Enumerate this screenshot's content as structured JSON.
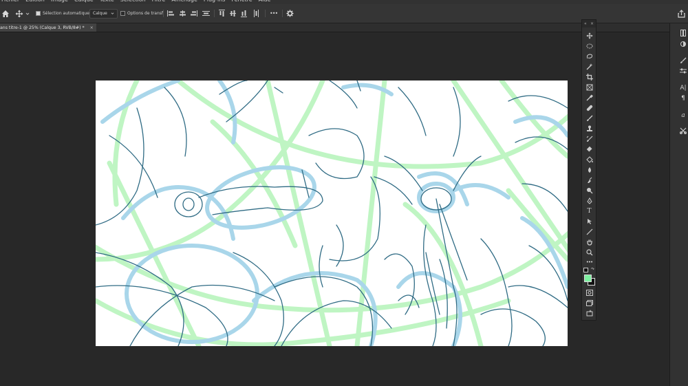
{
  "menu": {
    "items": [
      "Fichier",
      "Edition",
      "Image",
      "Calque",
      "Texte",
      "Sélection",
      "Filtre",
      "Affichage",
      "Plug-ins",
      "Fenêtre",
      "Aide"
    ]
  },
  "options": {
    "auto_select_label": "Sélection automatique :",
    "auto_select_checked": true,
    "target_value": "Calque",
    "transform_label": "Options de transf.",
    "transform_checked": false,
    "more_label": "•••"
  },
  "document": {
    "tab_title": "ans titre-1 @ 25% (Calque 3, RVB/8#) *",
    "close_label": "×"
  },
  "toolbox": {
    "collapse_label": "«",
    "close_label": "×",
    "more_label": "•••",
    "tools": [
      "move",
      "marquee",
      "lasso",
      "magic-wand",
      "crop",
      "frame",
      "eyedropper",
      "healing-brush",
      "brush",
      "clone-stamp",
      "history-brush",
      "eraser",
      "paint-bucket",
      "blur",
      "dodge",
      "pen",
      "type",
      "path-selection",
      "line",
      "hand",
      "zoom"
    ],
    "foreground_color": "#111111",
    "background_color": "#7ef0a0"
  },
  "colors": {
    "sketch_green": "#bff5c3",
    "sketch_blue": "#a9d6ea",
    "sketch_line": "#2f6b84"
  }
}
